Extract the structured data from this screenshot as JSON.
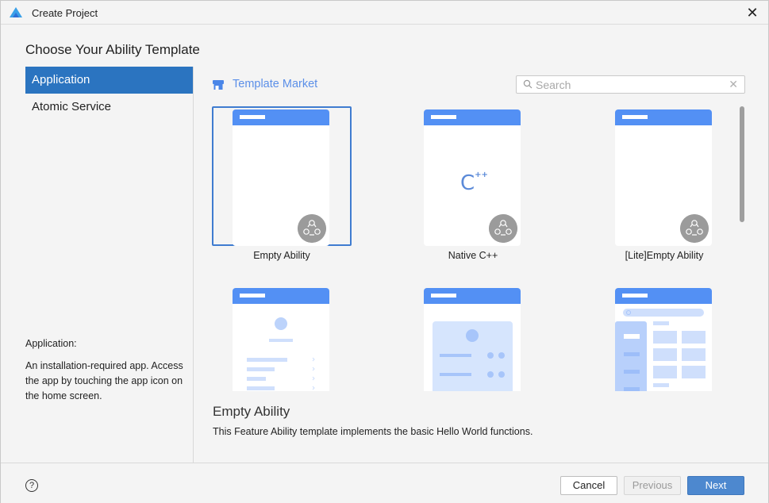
{
  "window": {
    "title": "Create Project",
    "close_icon": "close-icon"
  },
  "heading": "Choose Your Ability Template",
  "sidebar": {
    "items": [
      {
        "label": "Application",
        "active": true
      },
      {
        "label": "Atomic Service",
        "active": false
      }
    ],
    "description_label": "Application:",
    "description_text": "An installation-required app. Access the app by touching the app icon on the home screen."
  },
  "market": {
    "label": "Template Market",
    "icon": "store-icon"
  },
  "search": {
    "placeholder": "Search",
    "value": ""
  },
  "templates": [
    {
      "label": "Empty Ability",
      "selected": true,
      "preview": "empty"
    },
    {
      "label": "Native C++",
      "selected": false,
      "preview": "cpp"
    },
    {
      "label": "[Lite]Empty Ability",
      "selected": false,
      "preview": "empty"
    },
    {
      "label": "",
      "selected": false,
      "preview": "profile-list"
    },
    {
      "label": "",
      "selected": false,
      "preview": "card-panel"
    },
    {
      "label": "",
      "selected": false,
      "preview": "category-grid"
    }
  ],
  "cpp_glyph": "C",
  "cpp_plus": "++",
  "detail": {
    "title": "Empty Ability",
    "description": "This Feature Ability template implements the basic Hello World functions."
  },
  "footer": {
    "help": "?",
    "cancel": "Cancel",
    "previous": "Previous",
    "next": "Next"
  },
  "colors": {
    "accent": "#2b74c0",
    "template_bar": "#5390f4",
    "market_text": "#5b8fe8",
    "next_button": "#4d88cf"
  }
}
